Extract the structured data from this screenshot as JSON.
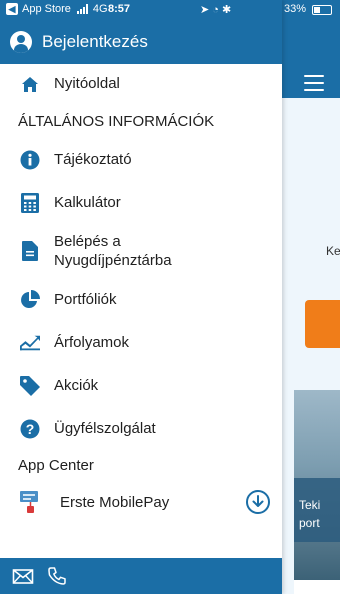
{
  "status_bar": {
    "carrier_back": "App Store",
    "network": "4G",
    "time": "8:57",
    "battery": "33%"
  },
  "drawer": {
    "login_label": "Bejelentkezés",
    "items": [
      {
        "label": "Nyitóoldal",
        "icon": "home-icon"
      },
      {
        "label": "Tájékoztató",
        "icon": "info-icon"
      },
      {
        "label": "Kalkulátor",
        "icon": "calculator-icon"
      },
      {
        "label": "Belépés a Nyugdíjpénztárba",
        "line1": "Belépés a",
        "line2": "Nyugdíjpénztárba",
        "icon": "document-icon"
      },
      {
        "label": "Portfóliók",
        "icon": "pie-chart-icon"
      },
      {
        "label": "Árfolyamok",
        "icon": "line-chart-icon"
      },
      {
        "label": "Akciók",
        "icon": "tag-icon"
      },
      {
        "label": "Ügyfélszolgálat",
        "icon": "help-icon"
      }
    ],
    "section_general": "ÁLTALÁNOS INFORMÁCIÓK",
    "app_center": {
      "title": "App Center",
      "app_name": "Erste MobilePay",
      "action_icon": "download-icon"
    },
    "footer_icons": [
      "mail-icon",
      "phone-icon"
    ]
  },
  "background_app": {
    "partial_label": "Ke",
    "partial_banner_line1": "Teki",
    "partial_banner_line2": "port"
  },
  "colors": {
    "brand_blue": "#1b6ea6",
    "accent_orange": "#f07d19"
  }
}
